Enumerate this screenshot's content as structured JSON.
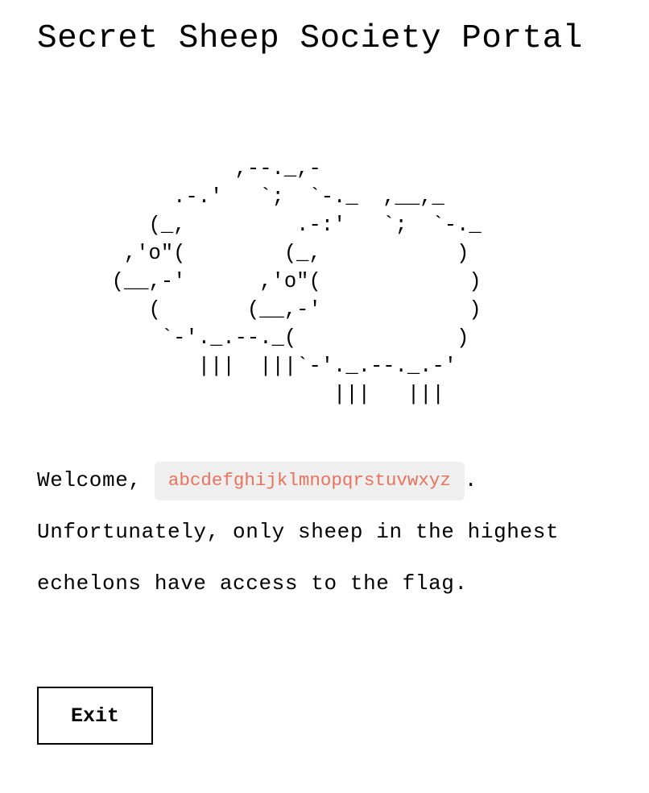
{
  "page": {
    "title": "Secret Sheep Society Portal",
    "ascii_art": "            ,--._,-\n       .-.'   `;  `-._  ,__,_\n     (_,         .-:'   `;  `-._\n   ,'o\"(        (_,           )\n  (__,-'      ,'o\"(            )\n     (       (__,-'            )\n      `-'._.--._(             )\n         |||  |||`-'._.--._.-'\n                    |||   |||"
  },
  "welcome": {
    "greeting": "Welcome,",
    "username": "abcdefghijklmnopqrstuvwxyz",
    "period": ".",
    "message": "Unfortunately, only sheep in the highest echelons have access to the flag."
  },
  "actions": {
    "exit_label": "Exit"
  },
  "colors": {
    "username_text": "#e8735d",
    "username_background": "#efefef"
  }
}
